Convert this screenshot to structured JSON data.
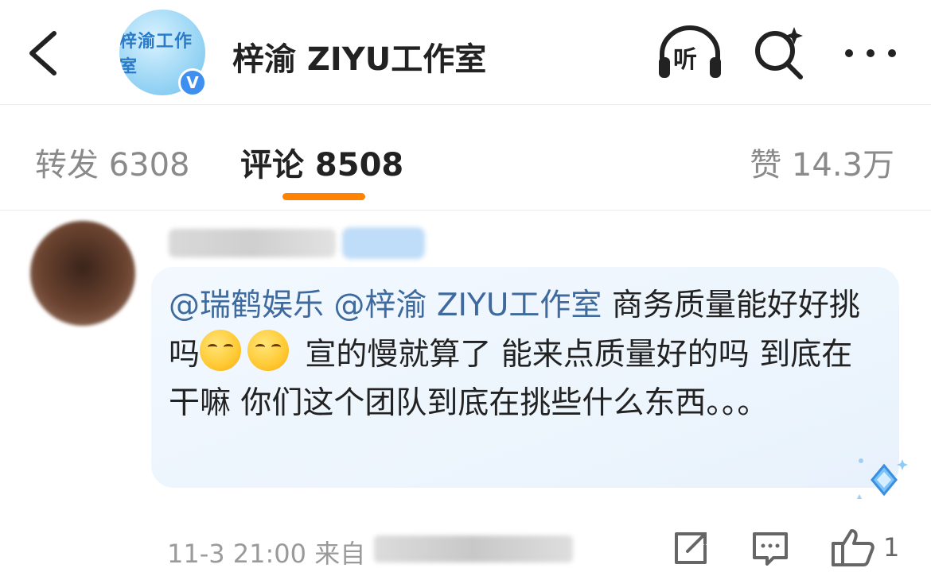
{
  "header": {
    "title": "梓渝 ZIYU工作室",
    "avatar_text": "梓渝工作室",
    "verified_mark": "V",
    "listen_label": "听",
    "icons": {
      "back": "back-arrow-icon",
      "listen": "headphones-icon",
      "search": "search-icon",
      "more": "more-dots-icon"
    }
  },
  "tabs": {
    "repost": "转发 6308",
    "comment": "评论 8508",
    "like": "赞 14.3万",
    "active": "comment",
    "accent_color": "#ff8200"
  },
  "comment": {
    "mention_1": "@瑞鹤娱乐",
    "mention_2": "@梓渝 ZIYU工作室",
    "text_1": " 商务质量能好好挑吗",
    "text_2": " 宣的慢就算了 能来点质量好的吗 到底在干嘛 你们这个团队到底在挑些什么东西。。。",
    "emoji": "thinking-face-emoji",
    "time": "11-3 21:00",
    "source_prefix": "来自",
    "like_count": "1",
    "mention_color": "#3e6a9e",
    "icons": {
      "share": "share-icon",
      "reply": "comment-bubble-icon",
      "like": "thumbs-up-icon"
    }
  }
}
